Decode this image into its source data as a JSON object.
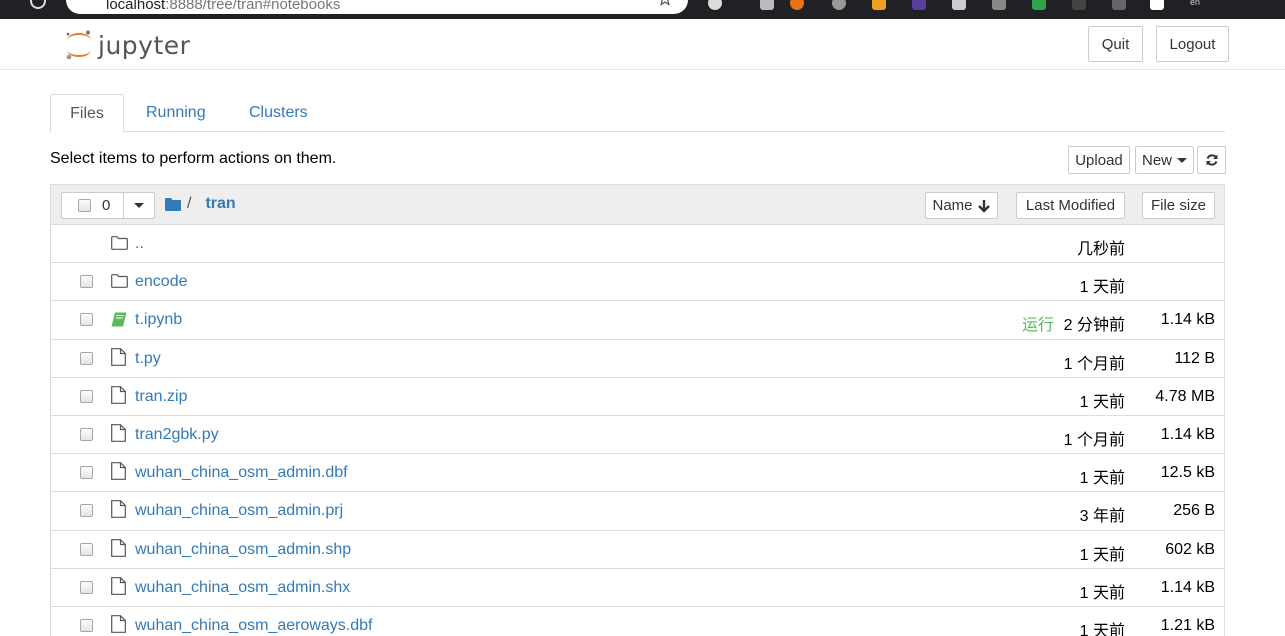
{
  "browser": {
    "url_host": "localhost",
    "url_rest": ":8888/tree/tran#notebooks",
    "lang_badge": "en"
  },
  "header": {
    "logo_text": "jupyter",
    "quit_label": "Quit",
    "logout_label": "Logout"
  },
  "tabs": [
    {
      "label": "Files",
      "active": true
    },
    {
      "label": "Running"
    },
    {
      "label": "Clusters"
    }
  ],
  "toolbar": {
    "instruction": "Select items to perform actions on them.",
    "upload_label": "Upload",
    "new_label": "New"
  },
  "list_header": {
    "selected_count": "0",
    "breadcrumb_sep": "/",
    "breadcrumb_dir": "tran",
    "sort_name_label": "Name",
    "sort_modified_label": "Last Modified",
    "sort_size_label": "File size"
  },
  "rows": [
    {
      "name": "..",
      "type": "folder",
      "modified": "几秒前",
      "size": "",
      "checkbox": false
    },
    {
      "name": "encode",
      "type": "folder",
      "modified": "1 天前",
      "size": "",
      "checkbox": true
    },
    {
      "name": "t.ipynb",
      "type": "notebook",
      "status": "运行",
      "modified": "2 分钟前",
      "size": "1.14 kB",
      "checkbox": true
    },
    {
      "name": "t.py",
      "type": "file",
      "modified": "1 个月前",
      "size": "112 B",
      "checkbox": true
    },
    {
      "name": "tran.zip",
      "type": "file",
      "modified": "1 天前",
      "size": "4.78 MB",
      "checkbox": true
    },
    {
      "name": "tran2gbk.py",
      "type": "file",
      "modified": "1 个月前",
      "size": "1.14 kB",
      "checkbox": true
    },
    {
      "name": "wuhan_china_osm_admin.dbf",
      "type": "file",
      "modified": "1 天前",
      "size": "12.5 kB",
      "checkbox": true
    },
    {
      "name": "wuhan_china_osm_admin.prj",
      "type": "file",
      "modified": "3 年前",
      "size": "256 B",
      "checkbox": true
    },
    {
      "name": "wuhan_china_osm_admin.shp",
      "type": "file",
      "modified": "1 天前",
      "size": "602 kB",
      "checkbox": true
    },
    {
      "name": "wuhan_china_osm_admin.shx",
      "type": "file",
      "modified": "1 天前",
      "size": "1.14 kB",
      "checkbox": true
    },
    {
      "name": "wuhan_china_osm_aeroways.dbf",
      "type": "file",
      "modified": "1 天前",
      "size": "1.21 kB",
      "checkbox": true
    }
  ],
  "colors": {
    "link": "#337ab7",
    "running": "#5cb85c",
    "logo_orange": "#f37626",
    "header_bg": "#eeeeee"
  },
  "icons": {
    "folder": "folder-icon",
    "notebook": "notebook-icon",
    "file": "file-icon",
    "refresh": "refresh-icon",
    "sort": "arrow-down-icon"
  }
}
